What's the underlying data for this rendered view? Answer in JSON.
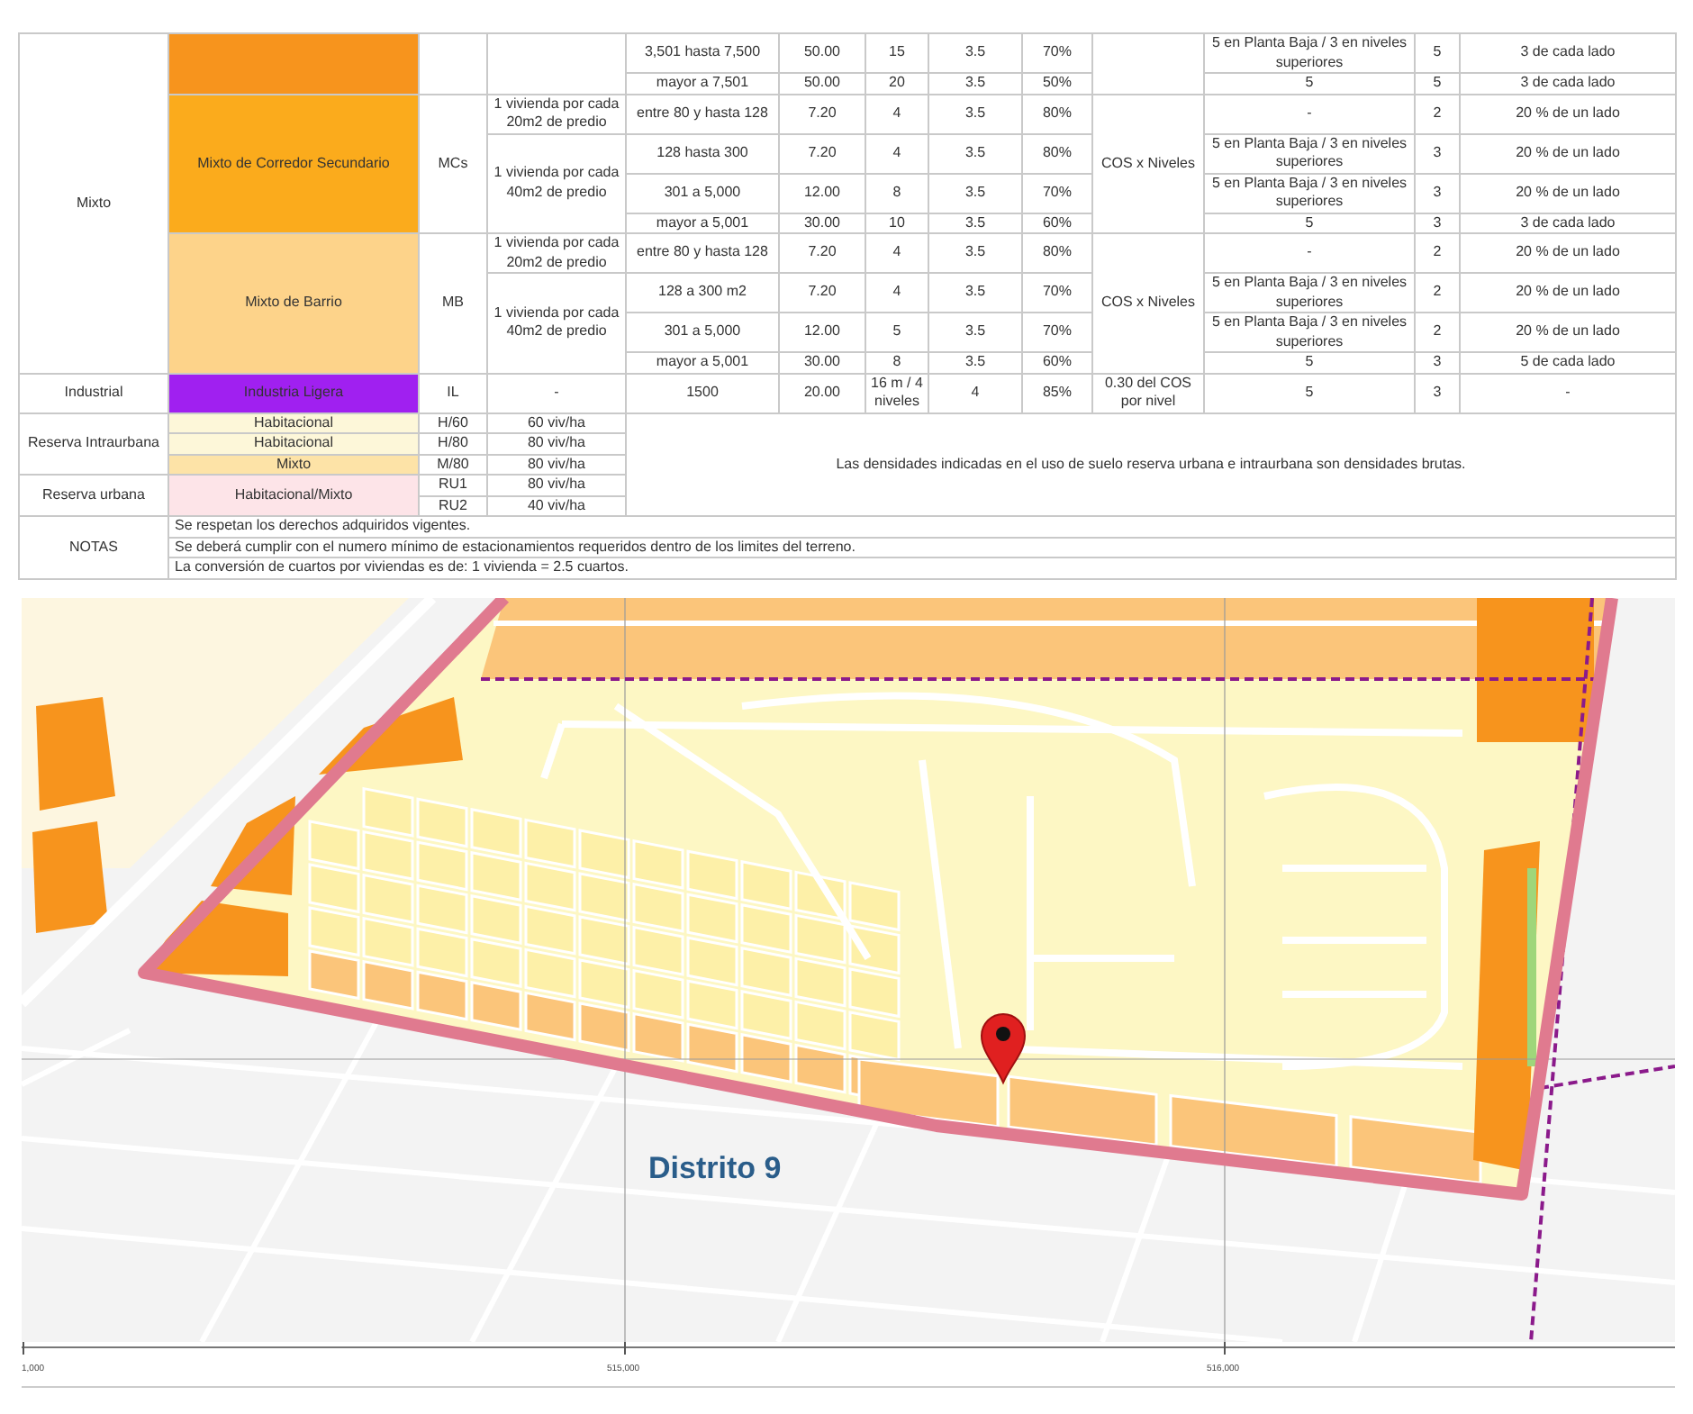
{
  "table": {
    "zones": [
      {
        "category": "Mixto",
        "uses": [
          {
            "color": "#f7941d",
            "densities": [
              {
                "lots": [
                  {
                    "column_5": "3,501 hasta 7,500",
                    "column_6": "50.00",
                    "column_7": "15",
                    "column_8": "3.5",
                    "column_9": "70%",
                    "column_11": "5 en Planta Baja / 3 en niveles superiores",
                    "column_12": "5",
                    "column_13": "3 de cada lado"
                  },
                  {
                    "column_5": "mayor a 7,501",
                    "column_6": "50.00",
                    "column_7": "20",
                    "column_8": "3.5",
                    "column_9": "50%",
                    "column_11": "5",
                    "column_12": "5",
                    "column_13": "3 de cada lado"
                  }
                ]
              }
            ]
          },
          {
            "name": "Mixto de Corredor Secundario",
            "color": "#fbab1c",
            "code": "MCs",
            "column_10": "COS x Niveles",
            "densities": [
              {
                "density": "1 vivienda por cada 20m2 de predio",
                "lots": [
                  {
                    "column_5": "entre 80 y hasta 128",
                    "column_6": "7.20",
                    "column_7": "4",
                    "column_8": "3.5",
                    "column_9": "80%",
                    "column_11": "-",
                    "column_12": "2",
                    "column_13": "20 % de un lado"
                  }
                ]
              },
              {
                "density": "1 vivienda por cada 40m2 de predio",
                "lots": [
                  {
                    "column_5": "128 hasta 300",
                    "column_6": "7.20",
                    "column_7": "4",
                    "column_8": "3.5",
                    "column_9": "80%",
                    "column_11": "5 en Planta Baja / 3 en niveles superiores",
                    "column_12": "3",
                    "column_13": "20 % de un lado"
                  },
                  {
                    "column_5": "301 a 5,000",
                    "column_6": "12.00",
                    "column_7": "8",
                    "column_8": "3.5",
                    "column_9": "70%",
                    "column_11": "5 en Planta Baja / 3 en niveles superiores",
                    "column_12": "3",
                    "column_13": "20 % de un lado"
                  },
                  {
                    "column_5": "mayor a 5,001",
                    "column_6": "30.00",
                    "column_7": "10",
                    "column_8": "3.5",
                    "column_9": "60%",
                    "column_11": "5",
                    "column_12": "3",
                    "column_13": "3 de cada lado"
                  }
                ]
              }
            ]
          },
          {
            "name": "Mixto de Barrio",
            "color": "#fdd38a",
            "code": "MB",
            "column_10": "COS x Niveles",
            "densities": [
              {
                "density": "1 vivienda por cada 20m2 de predio",
                "lots": [
                  {
                    "column_5": "entre 80 y hasta 128",
                    "column_6": "7.20",
                    "column_7": "4",
                    "column_8": "3.5",
                    "column_9": "80%",
                    "column_11": "-",
                    "column_12": "2",
                    "column_13": "20 % de un lado"
                  }
                ]
              },
              {
                "density": "1 vivienda por cada 40m2 de predio",
                "lots": [
                  {
                    "column_5": "128 a 300 m2",
                    "column_6": "7.20",
                    "column_7": "4",
                    "column_8": "3.5",
                    "column_9": "70%",
                    "column_11": "5 en Planta Baja / 3 en niveles superiores",
                    "column_12": "2",
                    "column_13": "20 % de un lado"
                  },
                  {
                    "column_5": "301 a 5,000",
                    "column_6": "12.00",
                    "column_7": "5",
                    "column_8": "3.5",
                    "column_9": "70%",
                    "column_11": "5 en Planta Baja / 3 en niveles superiores",
                    "column_12": "2",
                    "column_13": "20 % de un lado"
                  },
                  {
                    "column_5": "mayor a 5,001",
                    "column_6": "30.00",
                    "column_7": "8",
                    "column_8": "3.5",
                    "column_9": "60%",
                    "column_11": "5",
                    "column_12": "3",
                    "column_13": "5 de cada lado"
                  }
                ]
              }
            ]
          }
        ]
      },
      {
        "category": "Industrial",
        "uses": [
          {
            "name": "Industria Ligera",
            "color": "#a020f0",
            "code": "IL",
            "column_10": "0.30 del COS por nivel",
            "densities": [
              {
                "density": "-",
                "lots": [
                  {
                    "column_5": "1500",
                    "column_6": "20.00",
                    "column_7": "16 m / 4 niveles",
                    "column_8": "4",
                    "column_9": "85%",
                    "column_11": "5",
                    "column_12": "3",
                    "column_13": "-"
                  }
                ]
              }
            ]
          }
        ]
      }
    ],
    "reserves": {
      "groups": [
        {
          "category": "Reserva Intraurbana",
          "uses": [
            {
              "name": "Habitacional",
              "color": "#fdf7d9",
              "codes": [
                {
                  "code": "H/60",
                  "density": "60 viv/ha"
                }
              ]
            },
            {
              "name": "Habitacional",
              "color": "#fdf7d9",
              "codes": [
                {
                  "code": "H/80",
                  "density": "80 viv/ha"
                }
              ]
            },
            {
              "name": "Mixto",
              "color": "#fde3a7",
              "codes": [
                {
                  "code": "M/80",
                  "density": "80 viv/ha"
                }
              ]
            }
          ]
        },
        {
          "category": "Reserva urbana",
          "uses": [
            {
              "name": "Habitacional/Mixto",
              "color": "#fde4e8",
              "codes": [
                {
                  "code": "RU1",
                  "density": "80 viv/ha"
                },
                {
                  "code": "RU2",
                  "density": "40 viv/ha"
                }
              ]
            }
          ]
        }
      ],
      "note": "Las densidades indicadas en el uso de suelo reserva urbana e intraurbana son densidades brutas."
    },
    "notes": {
      "label": "NOTAS",
      "items": [
        "Se respetan los derechos adquiridos vigentes.",
        "Se deberá cumplir con el numero mínimo de estacionamientos requeridos dentro de los limites del terreno.",
        "La conversión de cuartos por viviendas es de: 1 vivienda = 2.5 cuartos."
      ]
    }
  },
  "map": {
    "district_label": "Distrito 9",
    "axis_labels": [
      "1,000",
      "515,000",
      "516,000"
    ]
  }
}
